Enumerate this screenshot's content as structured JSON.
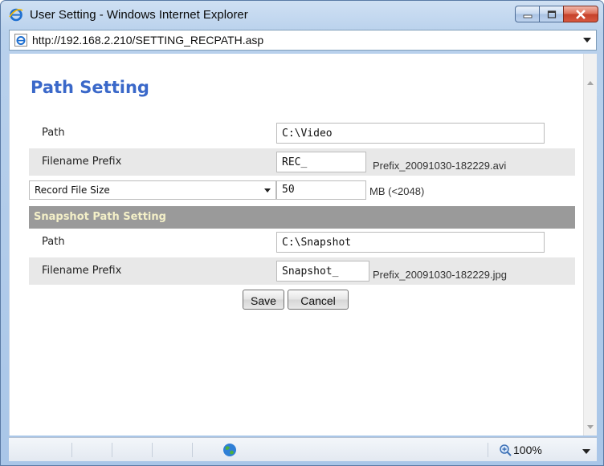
{
  "window": {
    "title": "User Setting - Windows Internet Explorer",
    "controls": {
      "minimize": "minimize-icon",
      "maximize": "maximize-icon",
      "close": "close-icon"
    }
  },
  "address": {
    "url": "http://192.168.2.210/SETTING_RECPATH.asp"
  },
  "page": {
    "title": "Path Setting",
    "record": {
      "path_label": "Path",
      "path_value": "C:\\Video",
      "prefix_label": "Filename Prefix",
      "prefix_value": "REC_",
      "prefix_example": "Prefix_20091030-182229.avi",
      "size_select": "Record File Size",
      "size_value": "50",
      "size_unit": "MB (<2048)"
    },
    "snapshot": {
      "header": "Snapshot Path Setting",
      "path_label": "Path",
      "path_value": "C:\\Snapshot",
      "prefix_label": "Filename Prefix",
      "prefix_value": "Snapshot_",
      "prefix_example": "Prefix_20091030-182229.jpg"
    },
    "buttons": {
      "save": "Save",
      "cancel": "Cancel"
    }
  },
  "statusbar": {
    "zoom": "100%"
  },
  "colors": {
    "title_blue": "#3a68c9",
    "section_header_bg": "#9a9a9a",
    "section_header_text": "#f4f0c8",
    "row_shade": "#e8e8e8"
  }
}
